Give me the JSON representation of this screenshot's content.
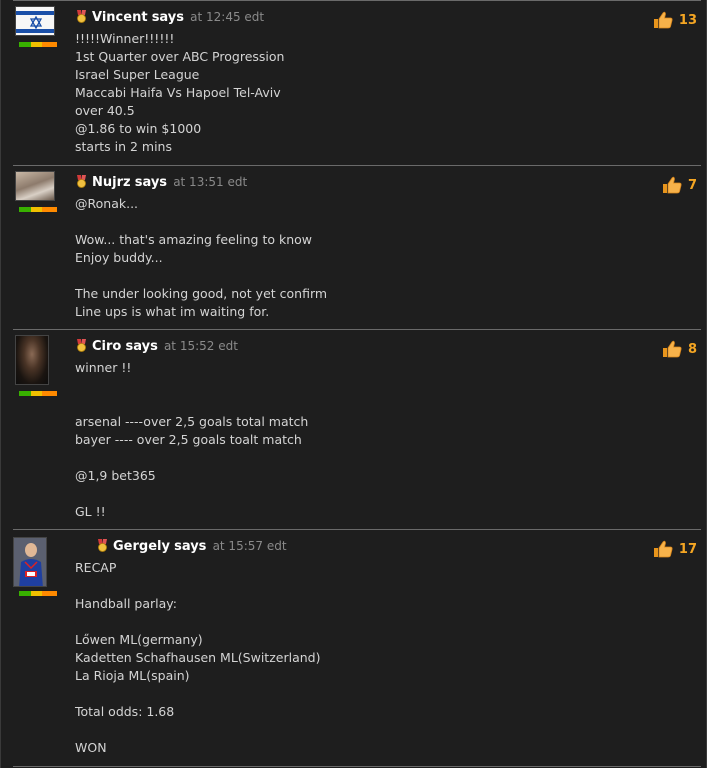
{
  "comments": [
    {
      "author": "Vincent",
      "says": "says",
      "time": "at 12:45 edt",
      "likes": "13",
      "avatar": "israel-flag",
      "lines": "!!!!!Winner!!!!!!\n1st Quarter over ABC Progression\nIsrael Super League\nMaccabi Haifa Vs Hapoel Tel-Aviv\nover 40.5\n@1.86 to win $1000\nstarts in 2 mins"
    },
    {
      "author": "Nujrz",
      "says": "says",
      "time": "at 13:51 edt",
      "likes": "7",
      "avatar": "photo",
      "lines": "@Ronak...\n\nWow... that's amazing feeling to know\nEnjoy buddy...\n\nThe under looking good, not yet confirm\nLine ups is what im waiting for."
    },
    {
      "author": "Ciro",
      "says": "says",
      "time": "at 15:52 edt",
      "likes": "8",
      "avatar": "photo",
      "lines": "winner !!\n\n\narsenal ----over 2,5 goals total match\nbayer ---- over 2,5 goals toalt match\n\n@1,9 bet365\n\nGL !!"
    },
    {
      "author": "Gergely",
      "says": "says",
      "time": "at 15:57 edt",
      "likes": "17",
      "avatar": "basketball-player",
      "lines": "RECAP\n\nHandball parlay:\n\nLőwen ML(germany)\nKadetten Schafhausen ML(Switzerland)\nLa Rioja ML(spain)\n\nTotal odds: 1.68\n\nWON"
    }
  ],
  "colors": {
    "background": "#1e1e1e",
    "likes": "#f5a623",
    "author": "#ffffff",
    "timestamp": "#8a8a8a"
  }
}
